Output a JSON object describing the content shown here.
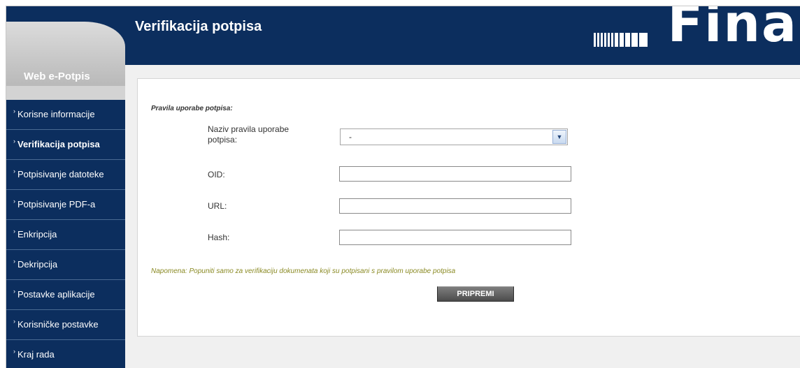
{
  "app": {
    "brand": "Web e-Potpis",
    "logo_text": "Fina"
  },
  "header": {
    "title": "Verifikacija potpisa"
  },
  "sidebar": {
    "items": [
      {
        "label": "Korisne informacije",
        "active": false
      },
      {
        "label": "Verifikacija potpisa",
        "active": true
      },
      {
        "label": "Potpisivanje datoteke",
        "active": false
      },
      {
        "label": "Potpisivanje PDF-a",
        "active": false
      },
      {
        "label": "Enkripcija",
        "active": false
      },
      {
        "label": "Dekripcija",
        "active": false
      },
      {
        "label": "Postavke aplikacije",
        "active": false
      },
      {
        "label": "Korisničke postavke",
        "active": false
      },
      {
        "label": "Kraj rada",
        "active": false
      }
    ]
  },
  "form": {
    "section_label": "Pravila uporabe potpisa:",
    "rule_name_label": "Naziv pravila uporabe potpisa:",
    "rule_name_value": "-",
    "oid_label": "OID:",
    "oid_value": "",
    "url_label": "URL:",
    "url_value": "",
    "hash_label": "Hash:",
    "hash_value": "",
    "note": "Napomena: Popuniti samo za verifikaciju dokumenata koji su potpisani s pravilom uporabe potpisa",
    "submit_label": "PRIPREMI"
  },
  "colors": {
    "header_bg": "#0c2e5e",
    "sidebar_bg": "#0c2e5e",
    "note_text": "#8a8a24",
    "button_bg": "#5e5e5e"
  }
}
